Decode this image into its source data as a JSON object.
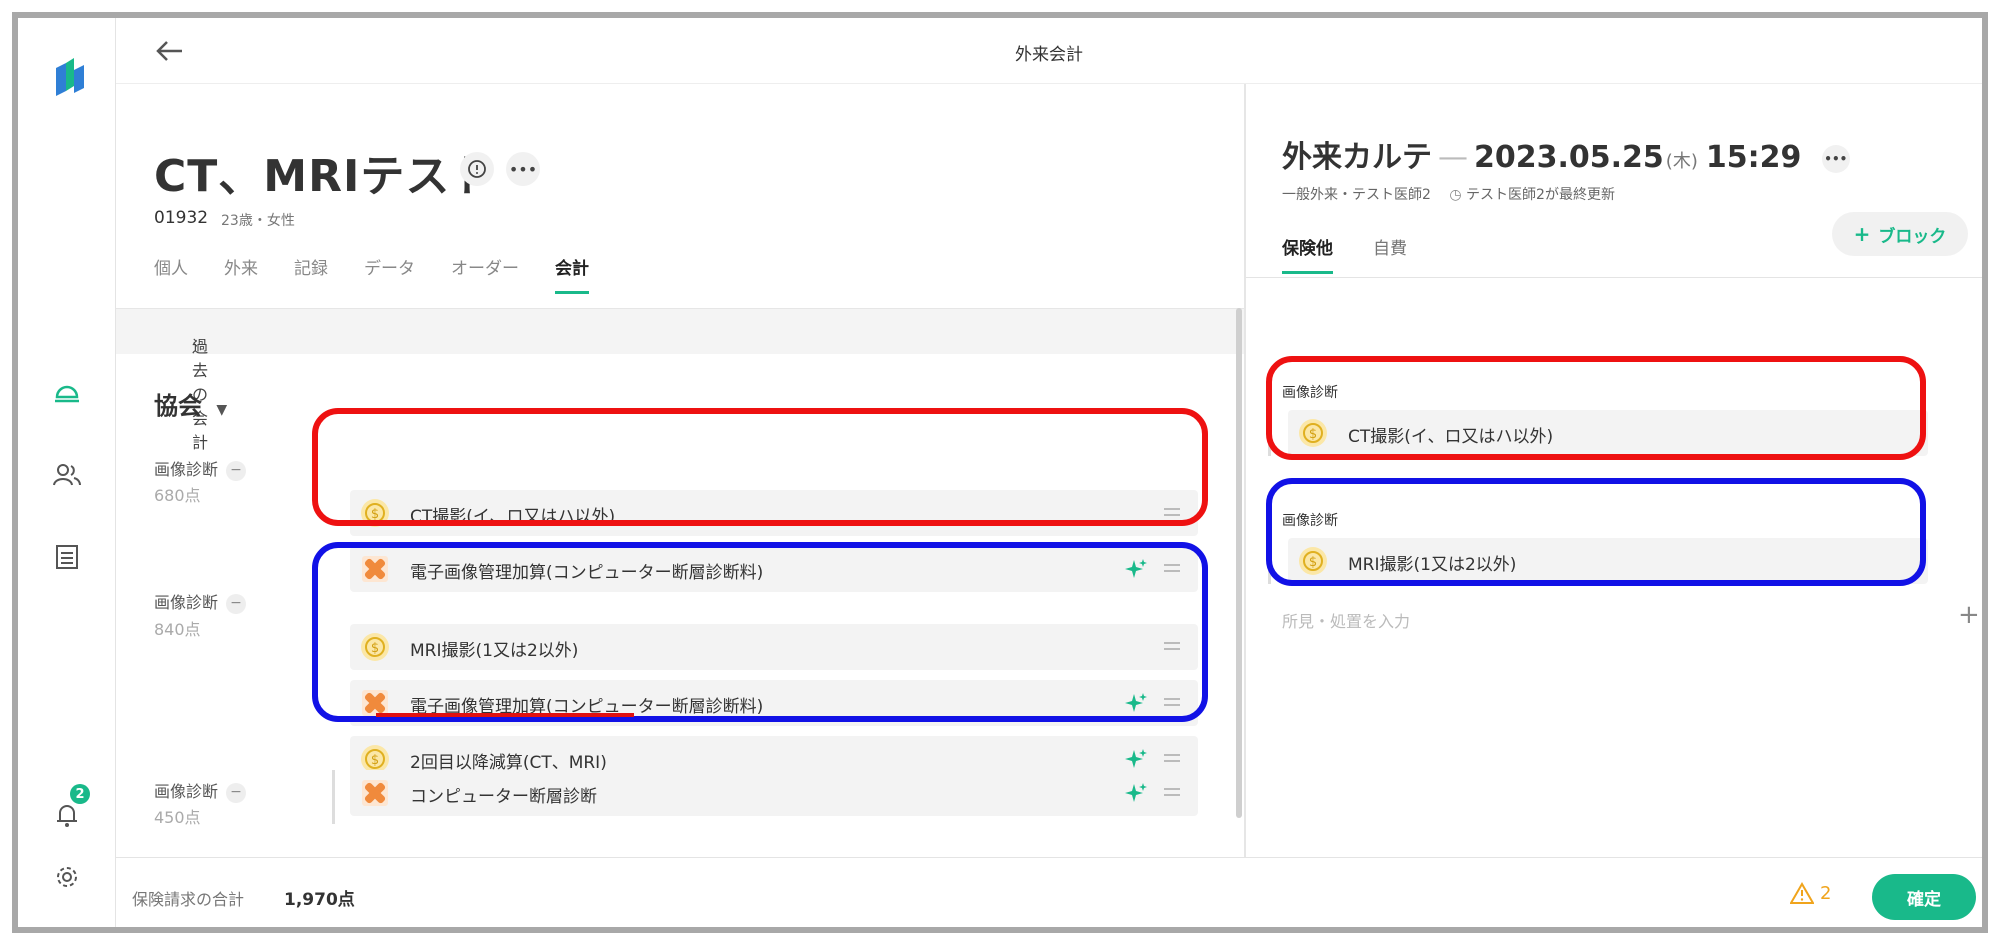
{
  "app": {
    "title": "外来会計"
  },
  "patient": {
    "name": "CT、MRIテスト",
    "id": "01932",
    "age_sex": "23歳・女性"
  },
  "tabs": [
    "個人",
    "外来",
    "記録",
    "データ",
    "オーダー",
    "会計"
  ],
  "active_tab": "会計",
  "past_accounting": "過去の会計",
  "section": {
    "title": "協会"
  },
  "groups": [
    {
      "label": "画像診断",
      "points": "680点",
      "items": [
        {
          "icon": "coin-icon",
          "label": "CT撮影(イ、ロ又はハ以外)",
          "spark": false
        },
        {
          "icon": "bandage-icon",
          "label": "電子画像管理加算(コンピューター断層診断料)",
          "spark": true
        }
      ]
    },
    {
      "label": "画像診断",
      "points": "840点",
      "items": [
        {
          "icon": "coin-icon",
          "label": "MRI撮影(1又は2以外)",
          "spark": false
        },
        {
          "icon": "bandage-icon",
          "label": "電子画像管理加算(コンピューター断層診断料)",
          "spark": true
        },
        {
          "icon": "coin-icon",
          "label": "2回目以降減算(CT、MRI)",
          "spark": true
        }
      ]
    },
    {
      "label": "画像診断",
      "points": "450点",
      "items": [
        {
          "icon": "bandage-icon",
          "label": "コンピューター断層診断",
          "spark": true
        }
      ]
    }
  ],
  "chart": {
    "title": "外来カルテ",
    "date": "2023.05.25",
    "weekday": "(木)",
    "time": "15:29",
    "subtitle": "一般外来・テスト医師2",
    "updated": "テスト医師2が最終更新",
    "tabs": [
      "保険他",
      "自費"
    ],
    "active_tab": "保険他",
    "add_block": "ブロック",
    "groups": [
      {
        "label": "画像診断",
        "item": "CT撮影(イ、ロ又はハ以外)"
      },
      {
        "label": "画像診断",
        "item": "MRI撮影(1又は2以外)"
      }
    ],
    "input_placeholder": "所見・処置を入力"
  },
  "footer": {
    "total_label": "保険請求の合計",
    "total_value": "1,970点",
    "warning_count": "2",
    "confirm": "確定"
  },
  "nav": {
    "notification_count": "2"
  },
  "colors": {
    "accent": "#19b98a",
    "annotation_red": "#ee1111",
    "annotation_blue": "#1111e6",
    "warning": "#f0a41c"
  }
}
